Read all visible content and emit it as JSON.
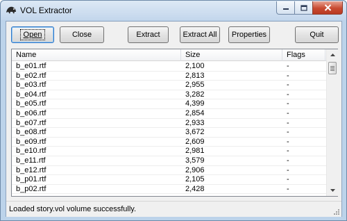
{
  "window": {
    "title": "VOL Extractor"
  },
  "toolbar": {
    "open_label": "Open",
    "close_label": "Close",
    "extract_label": "Extract",
    "extract_all_label": "Extract All",
    "properties_label": "Properties",
    "quit_label": "Quit"
  },
  "list": {
    "columns": [
      "Name",
      "Size",
      "Flags"
    ],
    "rows": [
      {
        "name": "b_e01.rtf",
        "size": "2,100",
        "flags": "-"
      },
      {
        "name": "b_e02.rtf",
        "size": "2,813",
        "flags": "-"
      },
      {
        "name": "b_e03.rtf",
        "size": "2,955",
        "flags": "-"
      },
      {
        "name": "b_e04.rtf",
        "size": "3,282",
        "flags": "-"
      },
      {
        "name": "b_e05.rtf",
        "size": "4,399",
        "flags": "-"
      },
      {
        "name": "b_e06.rtf",
        "size": "2,854",
        "flags": "-"
      },
      {
        "name": "b_e07.rtf",
        "size": "2,933",
        "flags": "-"
      },
      {
        "name": "b_e08.rtf",
        "size": "3,672",
        "flags": "-"
      },
      {
        "name": "b_e09.rtf",
        "size": "2,609",
        "flags": "-"
      },
      {
        "name": "b_e10.rtf",
        "size": "2,981",
        "flags": "-"
      },
      {
        "name": "b_e11.rtf",
        "size": "3,579",
        "flags": "-"
      },
      {
        "name": "b_e12.rtf",
        "size": "2,906",
        "flags": "-"
      },
      {
        "name": "b_p01.rtf",
        "size": "2,105",
        "flags": "-"
      },
      {
        "name": "b_p02.rtf",
        "size": "2,428",
        "flags": "-"
      }
    ]
  },
  "status": {
    "text": "Loaded story.vol volume successfully."
  },
  "icons": {
    "app": "creature-icon",
    "minimize": "minimize-icon",
    "maximize": "maximize-icon",
    "close": "close-icon",
    "scroll_up": "scroll-up-icon",
    "scroll_down": "scroll-down-icon",
    "size_grip": "size-grip-icon"
  },
  "colors": {
    "close_button": "#c84a31",
    "frame": "#bcd3ea",
    "focus_button_border": "#2f76c7"
  }
}
